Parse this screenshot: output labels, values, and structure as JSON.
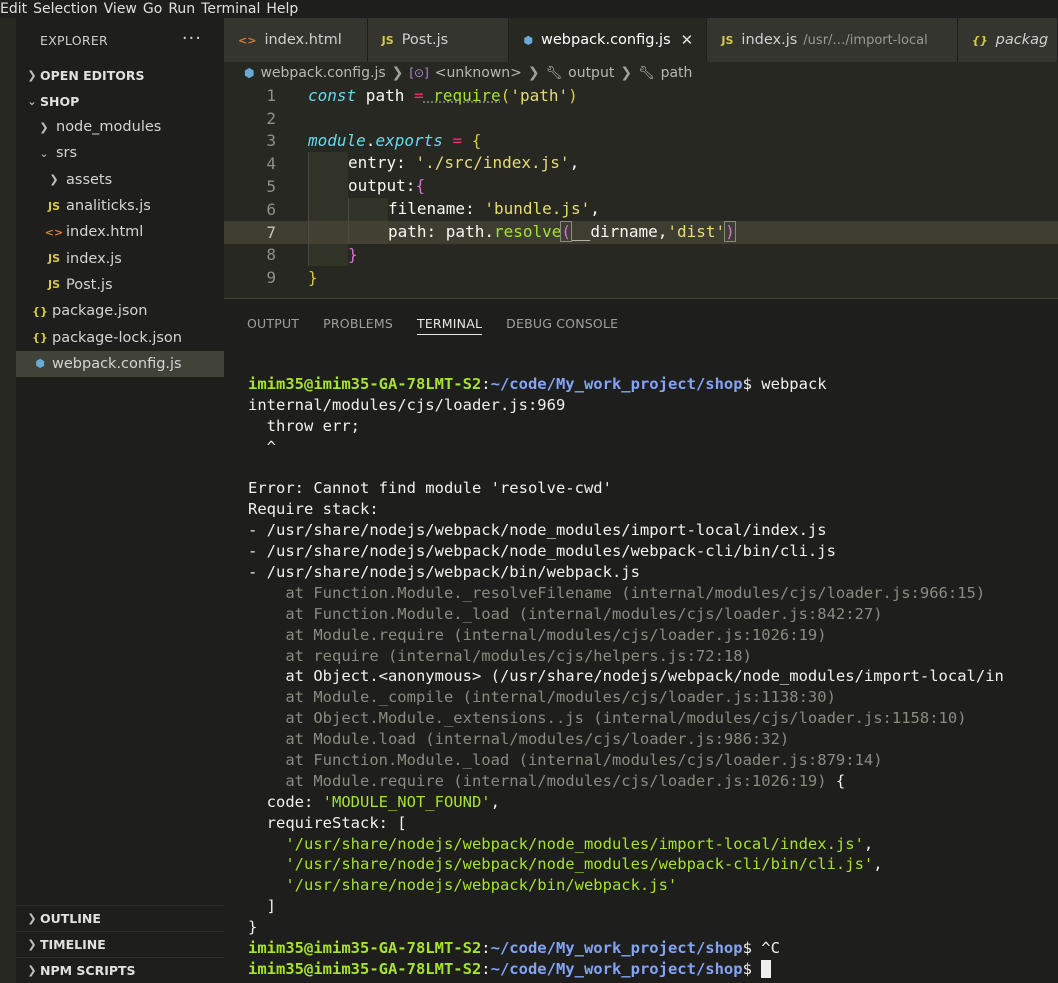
{
  "menubar": {
    "items": [
      "Edit",
      "Selection",
      "View",
      "Go",
      "Run",
      "Terminal",
      "Help"
    ]
  },
  "sidebar": {
    "title": "EXPLORER",
    "more": "···",
    "open_editors": "OPEN EDITORS",
    "project": "SHOP",
    "tree": [
      {
        "label": "node_modules",
        "type": "folder-closed"
      },
      {
        "label": "srs",
        "type": "folder-open"
      },
      {
        "label": "assets",
        "type": "folder-closed"
      },
      {
        "label": "analiticks.js",
        "type": "js"
      },
      {
        "label": "index.html",
        "type": "html"
      },
      {
        "label": "index.js",
        "type": "js"
      },
      {
        "label": "Post.js",
        "type": "js"
      },
      {
        "label": "package.json",
        "type": "json"
      },
      {
        "label": "package-lock.json",
        "type": "json"
      },
      {
        "label": "webpack.config.js",
        "type": "webpack"
      }
    ],
    "outline": "OUTLINE",
    "timeline": "TIMELINE",
    "npm_scripts": "NPM SCRIPTS"
  },
  "tabs": [
    {
      "label": "index.html",
      "icon": "<>",
      "sub": ""
    },
    {
      "label": "Post.js",
      "icon": "JS",
      "sub": ""
    },
    {
      "label": "webpack.config.js",
      "icon": "⬢",
      "sub": "",
      "close": "✕"
    },
    {
      "label": "index.js",
      "icon": "JS",
      "sub": "/usr/…/import-local"
    },
    {
      "label": "packag",
      "icon": "{}",
      "sub": ""
    }
  ],
  "breadcrumb": {
    "file": "webpack.config.js",
    "scope": "<unknown>",
    "prop1": "output",
    "prop2": "path"
  },
  "code": {
    "line_numbers": [
      "1",
      "2",
      "3",
      "4",
      "5",
      "6",
      "7",
      "8",
      "9"
    ],
    "l1": {
      "kw": "const",
      "name": " path ",
      "op": "=",
      "fn": " require",
      "open": "(",
      "str": "'path'",
      "close": ")"
    },
    "l3": {
      "obj": "module",
      "dot": ".",
      "prop": "exports",
      "op": " = ",
      "brace": "{"
    },
    "l4": {
      "key": "entry: ",
      "str": "'./src/index.js'",
      "comma": ","
    },
    "l5": {
      "key": "output:",
      "brace": "{"
    },
    "l6": {
      "key": "filename: ",
      "str": "'bundle.js'",
      "comma": ","
    },
    "l7": {
      "key": "path: path.",
      "fn": "resolve",
      "open": "(",
      "arg": "__dirname,",
      "str": "'dist'",
      "close": ")"
    },
    "l8": {
      "brace": "}"
    },
    "l9": {
      "brace": "}"
    }
  },
  "panel_tabs": [
    "OUTPUT",
    "PROBLEMS",
    "TERMINAL",
    "DEBUG CONSOLE"
  ],
  "terminal": {
    "prompt_user": "imim35@imim35-GA-78LMT-S2",
    "prompt_sep": ":",
    "prompt_path": "~/code/My_work_project/shop",
    "prompt_end": "$",
    "cmd1": " webpack",
    "lines": [
      "internal/modules/cjs/loader.js:969",
      "  throw err;",
      "  ^",
      "",
      "Error: Cannot find module 'resolve-cwd'",
      "Require stack:",
      "- /usr/share/nodejs/webpack/node_modules/import-local/index.js",
      "- /usr/share/nodejs/webpack/node_modules/webpack-cli/bin/cli.js",
      "- /usr/share/nodejs/webpack/bin/webpack.js"
    ],
    "stack": [
      {
        "text": "    at Function.Module._resolveFilename (internal/modules/cjs/loader.js:966:15)",
        "dim": true
      },
      {
        "text": "    at Function.Module._load (internal/modules/cjs/loader.js:842:27)",
        "dim": true
      },
      {
        "text": "    at Module.require (internal/modules/cjs/loader.js:1026:19)",
        "dim": true
      },
      {
        "text": "    at require (internal/modules/cjs/helpers.js:72:18)",
        "dim": true
      },
      {
        "text": "    at Object.<anonymous> (/usr/share/nodejs/webpack/node_modules/import-local/in",
        "dim": false
      },
      {
        "text": "    at Module._compile (internal/modules/cjs/loader.js:1138:30)",
        "dim": true
      },
      {
        "text": "    at Object.Module._extensions..js (internal/modules/cjs/loader.js:1158:10)",
        "dim": true
      },
      {
        "text": "    at Module.load (internal/modules/cjs/loader.js:986:32)",
        "dim": true
      },
      {
        "text": "    at Function.Module._load (internal/modules/cjs/loader.js:879:14)",
        "dim": true
      }
    ],
    "last_stack_dim": "    at Module.require (internal/modules/cjs/loader.js:1026:19)",
    "last_stack_tail": " {",
    "code_key": "  code: ",
    "code_val": "'MODULE_NOT_FOUND'",
    "code_comma": ",",
    "req_key": "  requireStack: [",
    "req_items": [
      "'/usr/share/nodejs/webpack/node_modules/import-local/index.js'",
      "'/usr/share/nodejs/webpack/node_modules/webpack-cli/bin/cli.js'",
      "'/usr/share/nodejs/webpack/bin/webpack.js'"
    ],
    "req_commas": [
      ",",
      ",",
      ""
    ],
    "req_close": "  ]",
    "obj_close": "}",
    "cmd2": " ^C",
    "cmd3": " "
  }
}
